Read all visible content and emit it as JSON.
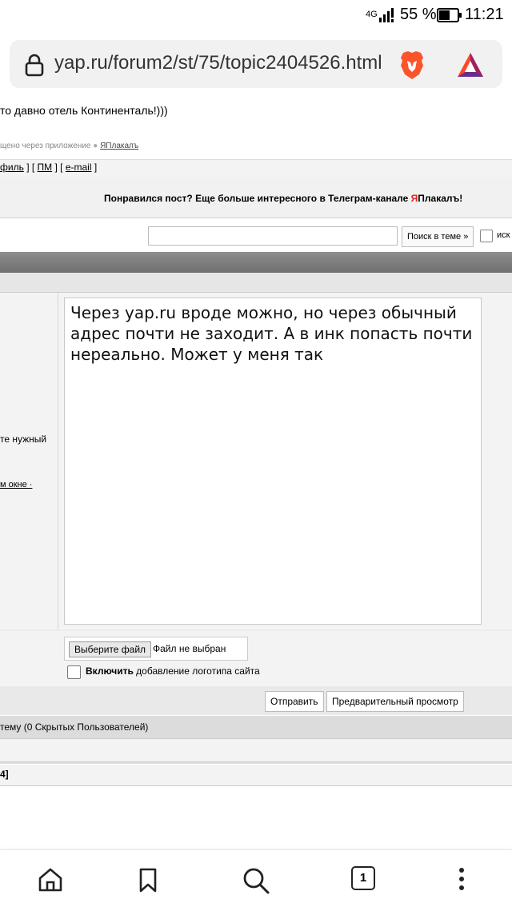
{
  "status_bar": {
    "network": "4G",
    "battery_percent": "55 %",
    "time": "11:21"
  },
  "browser": {
    "url": "yap.ru/forum2/st/75/topic2404526.html"
  },
  "post": {
    "text_tail": "то давно отель Континенталь!)))",
    "sent_via_prefix": "щено через приложение",
    "sent_via_app": "ЯПлакалъ",
    "links": {
      "profile": "филь",
      "pm": "ПМ",
      "email": "e-mail"
    }
  },
  "promo": {
    "text_before": "Понравился пост? Еще больше интересного в Телеграм-канале ",
    "ya": "Я",
    "plakal": "Плакалъ!"
  },
  "search": {
    "button_label": "Поиск в теме »",
    "checkbox_label": "иск"
  },
  "form": {
    "side_label_1": "те нужный",
    "side_label_2": "м окне ·",
    "message_text": "Через yap.ru вроде можно, но через обычный адрес почти не заходит. А в инк попасть почти нереально. Может у меня так",
    "file_button": "Выберите файл",
    "file_status": "Файл не выбран",
    "logo_bold": "Включить",
    "logo_rest": " добавление логотипа сайта",
    "send_button": "Отправить",
    "preview_button": "Предварительный просмотр"
  },
  "users_text": "тему (0 Скрытых Пользователей)",
  "pages_text": "4]",
  "bottom_nav": {
    "tabs_count": "1"
  },
  "colors": {
    "accent_red": "#e0231b",
    "dark_bar": "#7a7a7a"
  }
}
